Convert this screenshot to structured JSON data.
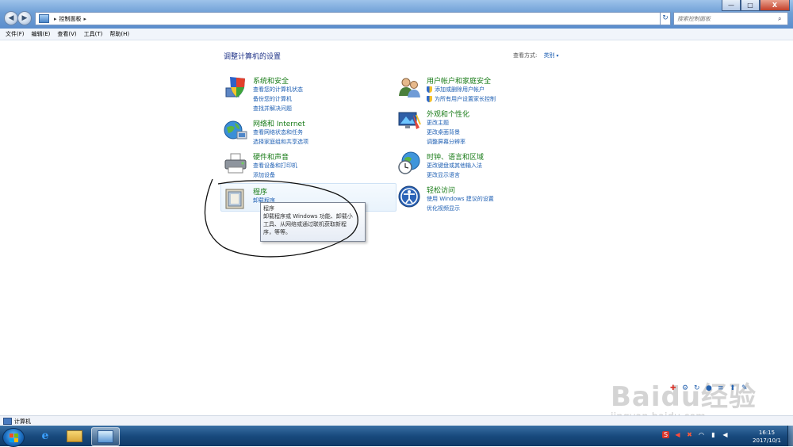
{
  "window": {
    "breadcrumb": "控制面板",
    "search_placeholder": "搜索控制面板",
    "controls": {
      "minimize": "—",
      "maximize": "□",
      "close": "X"
    }
  },
  "menu": [
    "文件(F)",
    "编辑(E)",
    "查看(V)",
    "工具(T)",
    "帮助(H)"
  ],
  "content": {
    "heading": "调整计算机的设置",
    "view_by_label": "查看方式:",
    "view_by_value": "类别"
  },
  "categories": [
    {
      "icon": "shield-computer-icon",
      "title": "系统和安全",
      "links": [
        "查看您的计算机状态",
        "备份您的计算机",
        "查找并解决问题"
      ]
    },
    {
      "icon": "network-globe-icon",
      "title": "网络和 Internet",
      "links": [
        "查看网络状态和任务",
        "选择家庭组和共享选项"
      ]
    },
    {
      "icon": "printer-icon",
      "title": "硬件和声音",
      "links": [
        "查看设备和打印机",
        "添加设备"
      ]
    },
    {
      "icon": "programs-box-icon",
      "title": "程序",
      "links": [
        "卸载程序"
      ]
    },
    {
      "icon": "users-icon",
      "title": "用户帐户和家庭安全",
      "links": [
        "添加或删除用户帐户",
        "为所有用户设置家长控制"
      ]
    },
    {
      "icon": "appearance-monitor-icon",
      "title": "外观和个性化",
      "links": [
        "更改主题",
        "更改桌面背景",
        "调整屏幕分辨率"
      ]
    },
    {
      "icon": "clock-globe-icon",
      "title": "时钟、语言和区域",
      "links": [
        "更改键盘或其他输入法",
        "更改显示语言"
      ]
    },
    {
      "icon": "ease-of-access-icon",
      "title": "轻松访问",
      "links": [
        "使用 Windows 建议的设置",
        "优化视频显示"
      ]
    }
  ],
  "tooltip": {
    "title": "程序",
    "line1": "卸载程序或 Windows 功能、卸载小",
    "line2": "工具、从网络或通过联机获取新程",
    "line3": "序，等等。"
  },
  "statusbar": {
    "text": "计算机"
  },
  "taskbar": {
    "apps": [
      "internet-explorer-icon",
      "file-explorer-icon",
      "control-panel-icon"
    ],
    "time": "16:15",
    "date": "2017/10/1"
  },
  "watermark": {
    "logo": "Baidu经验",
    "url": "jingyan.baidu.com"
  },
  "colors": {
    "category_title": "#1a7c19",
    "link": "#1e5fb3",
    "heading": "#1e3287"
  }
}
